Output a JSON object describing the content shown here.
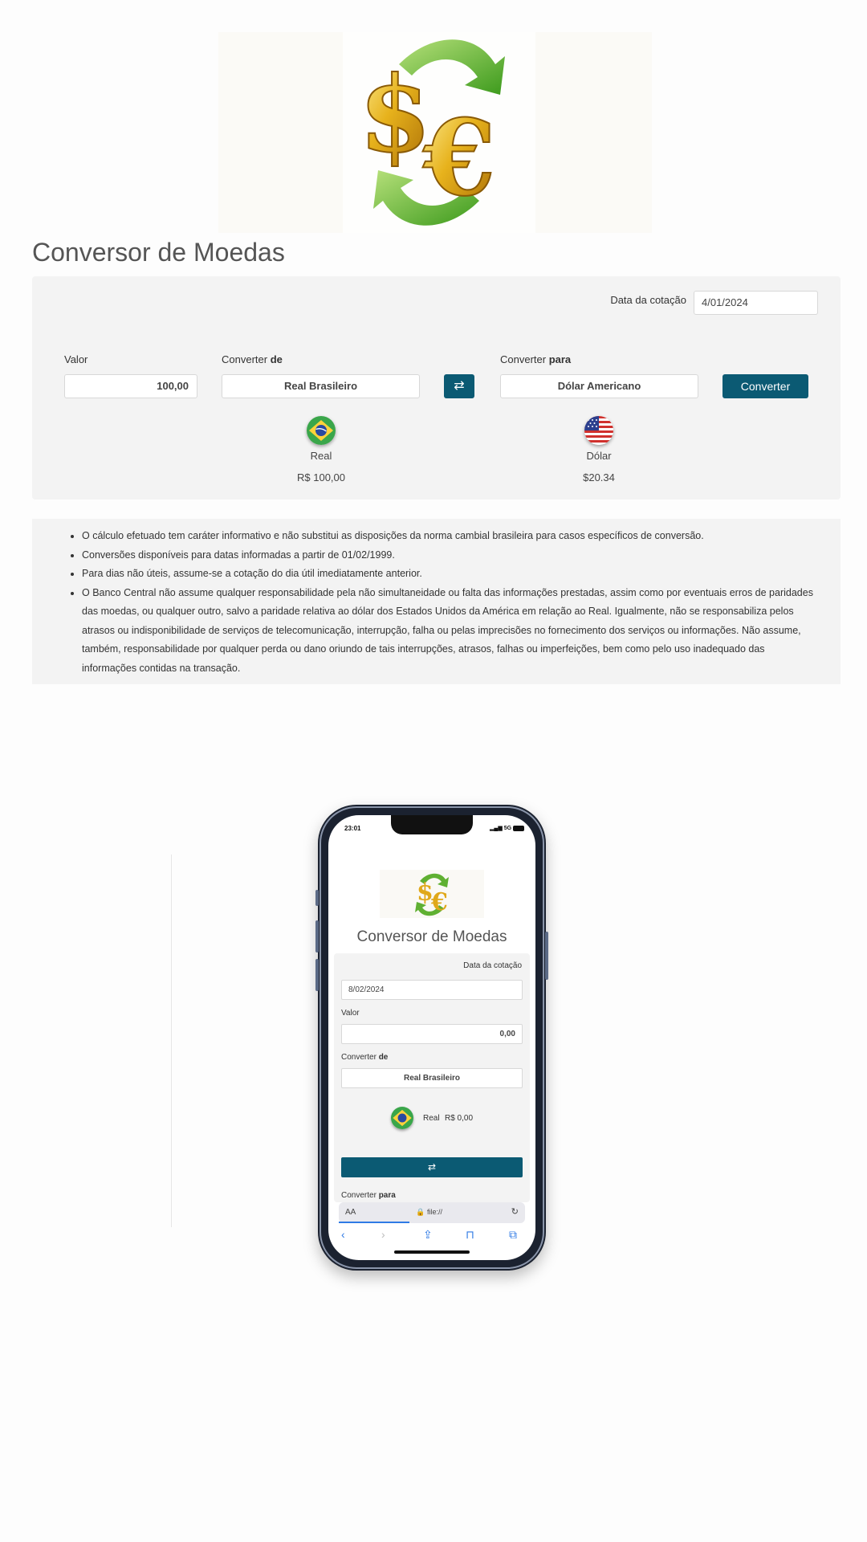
{
  "desktop": {
    "title": "Conversor de Moedas",
    "date_label": "Data da cotação",
    "date_value": "4/01/2024",
    "valor_label": "Valor",
    "valor_value": "100,00",
    "from_label_prefix": "Converter ",
    "from_label_bold": "de",
    "from_value": "Real Brasileiro",
    "to_label_prefix": "Converter ",
    "to_label_bold": "para",
    "to_value": "Dólar Americano",
    "swap_icon": "⇄",
    "convert_button": "Converter",
    "from_currency_name": "Real",
    "from_amount": "R$ 100,00",
    "to_currency_name": "Dólar",
    "to_amount": "$20.34"
  },
  "notes": [
    "O cálculo efetuado tem caráter informativo e não substitui as disposições da norma cambial brasileira para casos específicos de conversão.",
    "Conversões disponíveis para datas informadas a partir de 01/02/1999.",
    "Para dias não úteis, assume-se a cotação do dia útil imediatamente anterior.",
    "O Banco Central não assume qualquer responsabilidade pela não simultaneidade ou falta das informações prestadas, assim como por eventuais erros de paridades das moedas, ou qualquer outro, salvo a paridade relativa ao dólar dos Estados Unidos da América em relação ao Real. Igualmente, não se responsabiliza pelos atrasos ou indisponibilidade de serviços de telecomunicação, interrupção, falha ou pelas imprecisões no fornecimento dos serviços ou informações. Não assume, também, responsabilidade por qualquer perda ou dano oriundo de tais interrupções, atrasos, falhas ou imperfeições, bem como pelo uso inadequado das informações contidas na transação."
  ],
  "mobile": {
    "time": "23:01",
    "network": "5G",
    "title": "Conversor de Moedas",
    "date_label": "Data da cotação",
    "date_value": "8/02/2024",
    "valor_label": "Valor",
    "valor_value": "0,00",
    "from_label_prefix": "Converter ",
    "from_label_bold": "de",
    "from_value": "Real Brasileiro",
    "currency_name": "Real",
    "amount": "R$ 0,00",
    "swap_icon": "⇄",
    "to_label_prefix": "Converter ",
    "to_label_bold": "para",
    "url_aa": "AA",
    "url_text": "file://"
  },
  "colors": {
    "accent": "#0b5a73",
    "panel": "#f3f3f3",
    "ios_blue": "#2f7ae5"
  }
}
